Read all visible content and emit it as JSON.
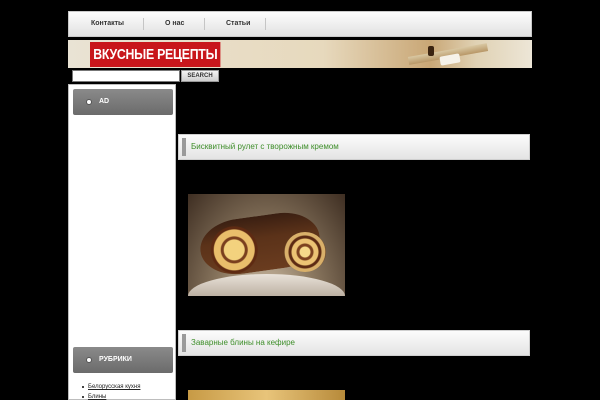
{
  "nav": {
    "items": [
      "Контакты",
      "О нас",
      "Статьи"
    ]
  },
  "header": {
    "logo_text": "ВКУСНЫЕ РЕЦЕПТЫ"
  },
  "search": {
    "value": "",
    "button_label": "SEARCH"
  },
  "sidebar": {
    "widgets": [
      {
        "title": "AD"
      },
      {
        "title": "РУБРИКИ"
      }
    ],
    "rubrics": [
      "Белорусская кухня",
      "Блины"
    ]
  },
  "posts": [
    {
      "title": "Бисквитный рулет с творожным кремом"
    },
    {
      "title": "Заварные блины на кефире"
    }
  ],
  "colors": {
    "accent_green": "#3e8e2a",
    "logo_red": "#c8161b",
    "background": "#000000"
  }
}
